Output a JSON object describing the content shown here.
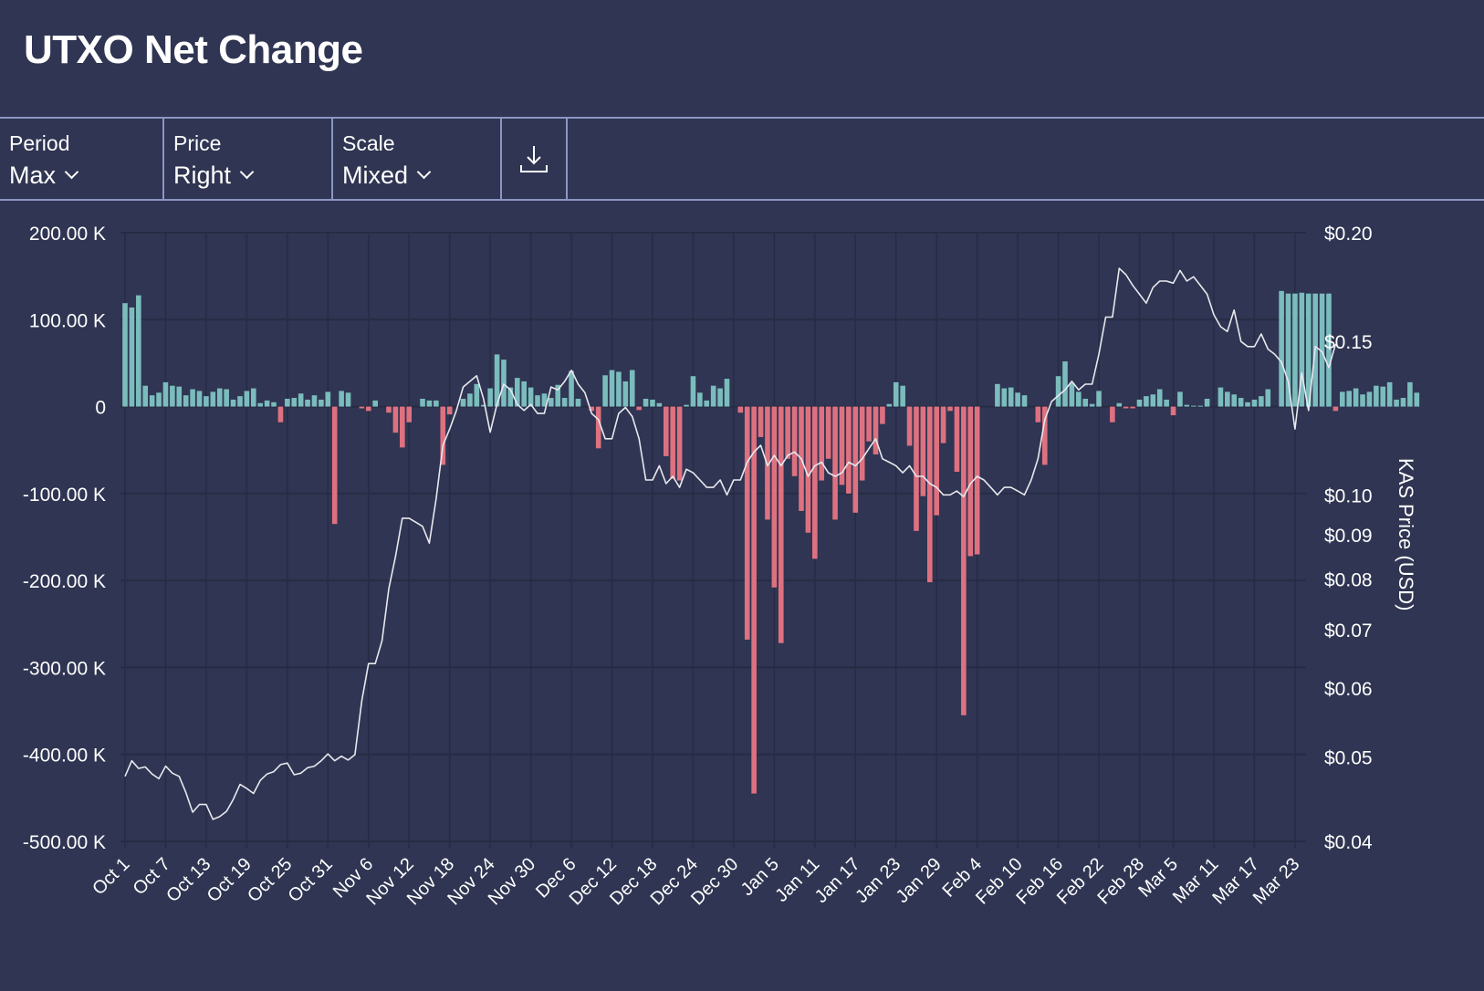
{
  "page": {
    "title": "UTXO Net Change"
  },
  "toolbar": {
    "period": {
      "label": "Period",
      "value": "Max"
    },
    "price": {
      "label": "Price",
      "value": "Right"
    },
    "scale": {
      "label": "Scale",
      "value": "Mixed"
    },
    "download_icon": "download-icon"
  },
  "colors": {
    "background": "#2f3552",
    "positive": "#7bbcbd",
    "negative": "#de7180",
    "price_line": "#e8e8ee",
    "grid": "#272c45",
    "divider": "#8b96c2"
  },
  "chart_data": {
    "type": "bar",
    "title": "UTXO Net Change",
    "xlabel": "",
    "ylabel": "",
    "y2label": "KAS Price (USD)",
    "ylim": [
      -500000,
      200000
    ],
    "y2lim": [
      0.04,
      0.2
    ],
    "y2scale": "log",
    "grid": true,
    "yticks": [
      "200.00 K",
      "100.00 K",
      "0",
      "-100.00 K",
      "-200.00 K",
      "-300.00 K",
      "-400.00 K",
      "-500.00 K"
    ],
    "ytick_values": [
      200000,
      100000,
      0,
      -100000,
      -200000,
      -300000,
      -400000,
      -500000
    ],
    "y2ticks": [
      "$0.20",
      "$0.15",
      "$0.10",
      "$0.09",
      "$0.08",
      "$0.07",
      "$0.06",
      "$0.05",
      "$0.04"
    ],
    "y2tick_values": [
      0.2,
      0.15,
      0.1,
      0.09,
      0.08,
      0.07,
      0.06,
      0.05,
      0.04
    ],
    "xticks": [
      "Oct 1",
      "Oct 7",
      "Oct 13",
      "Oct 19",
      "Oct 25",
      "Oct 31",
      "Nov 6",
      "Nov 12",
      "Nov 18",
      "Nov 24",
      "Nov 30",
      "Dec 6",
      "Dec 12",
      "Dec 18",
      "Dec 24",
      "Dec 30",
      "Jan 5",
      "Jan 11",
      "Jan 17",
      "Jan 23",
      "Jan 29",
      "Feb 4",
      "Feb 10",
      "Feb 16",
      "Feb 22",
      "Feb 28",
      "Mar 5",
      "Mar 11",
      "Mar 17",
      "Mar 23"
    ],
    "xtick_day_index": [
      0,
      6,
      12,
      18,
      24,
      30,
      36,
      42,
      48,
      54,
      60,
      66,
      72,
      78,
      84,
      90,
      96,
      102,
      108,
      114,
      120,
      126,
      132,
      138,
      144,
      150,
      155,
      161,
      167,
      173
    ],
    "series": [
      {
        "name": "UTXO Net Change",
        "type": "bar",
        "axis": "left",
        "values": [
          119000,
          114000,
          128000,
          24000,
          13000,
          16000,
          28000,
          24000,
          23000,
          13000,
          20000,
          18000,
          12000,
          17000,
          21000,
          20000,
          8000,
          12000,
          18000,
          21000,
          4000,
          7000,
          5000,
          -18000,
          9000,
          10000,
          15000,
          8000,
          13000,
          8000,
          17000,
          -135000,
          18000,
          16000,
          0,
          -2000,
          -5000,
          7000,
          0,
          -7000,
          -30000,
          -47000,
          -18000,
          0,
          9000,
          7000,
          7000,
          -67000,
          -9000,
          0,
          9000,
          15000,
          26000,
          2000,
          21000,
          60000,
          54000,
          22000,
          33000,
          29000,
          22000,
          13000,
          15000,
          10000,
          25000,
          10000,
          41000,
          9000,
          0,
          -5000,
          -48000,
          36000,
          42000,
          40000,
          29000,
          42000,
          -4000,
          9000,
          8000,
          4000,
          -57000,
          -83000,
          -85000,
          2000,
          35000,
          16000,
          7000,
          24000,
          21000,
          32000,
          0,
          -7000,
          -268000,
          -445000,
          -35000,
          -130000,
          -208000,
          -272000,
          -60000,
          -80000,
          -120000,
          -145000,
          -175000,
          -85000,
          -60000,
          -130000,
          -90000,
          -100000,
          -122000,
          -85000,
          -40000,
          -55000,
          -20000,
          3000,
          28000,
          24000,
          -45000,
          -143000,
          -103000,
          -202000,
          -125000,
          -42000,
          -5000,
          -75000,
          -355000,
          -172000,
          -170000,
          0,
          0,
          26000,
          21000,
          22000,
          16000,
          13000,
          0,
          -18000,
          -67000,
          0,
          35000,
          52000,
          27000,
          17000,
          9000,
          3000,
          18000,
          0,
          -18000,
          4000,
          -2000,
          -2000,
          8000,
          12000,
          14000,
          20000,
          8000,
          -10000,
          17000,
          2000,
          1000,
          1000,
          9000,
          0,
          22000,
          17000,
          14000,
          10000,
          5000,
          8000,
          12000,
          20000,
          0,
          133000,
          130000,
          130000,
          131000,
          130000,
          130000,
          130000,
          130000,
          -5000,
          17000,
          18000,
          21000,
          14000,
          17000,
          24000,
          23000,
          28000,
          8000,
          10000,
          28000,
          16000
        ]
      },
      {
        "name": "KAS Price (USD)",
        "type": "line",
        "axis": "right",
        "values": [
          0.0475,
          0.0495,
          0.0485,
          0.0487,
          0.0478,
          0.0472,
          0.0488,
          0.0479,
          0.0475,
          0.0455,
          0.0432,
          0.0441,
          0.0441,
          0.0424,
          0.0427,
          0.0433,
          0.0447,
          0.0465,
          0.046,
          0.0454,
          0.047,
          0.0478,
          0.0481,
          0.049,
          0.0492,
          0.0477,
          0.0479,
          0.0486,
          0.0488,
          0.0495,
          0.0504,
          0.0495,
          0.0501,
          0.0496,
          0.0503,
          0.058,
          0.064,
          0.064,
          0.068,
          0.078,
          0.085,
          0.094,
          0.094,
          0.093,
          0.092,
          0.088,
          0.099,
          0.114,
          0.119,
          0.125,
          0.133,
          0.135,
          0.137,
          0.129,
          0.118,
          0.127,
          0.134,
          0.132,
          0.127,
          0.125,
          0.127,
          0.124,
          0.124,
          0.133,
          0.132,
          0.135,
          0.139,
          0.134,
          0.131,
          0.124,
          0.122,
          0.116,
          0.116,
          0.124,
          0.126,
          0.123,
          0.116,
          0.104,
          0.104,
          0.108,
          0.103,
          0.105,
          0.102,
          0.107,
          0.106,
          0.104,
          0.102,
          0.102,
          0.104,
          0.1,
          0.104,
          0.104,
          0.109,
          0.112,
          0.114,
          0.108,
          0.111,
          0.108,
          0.111,
          0.112,
          0.11,
          0.105,
          0.108,
          0.109,
          0.106,
          0.105,
          0.106,
          0.109,
          0.108,
          0.11,
          0.113,
          0.116,
          0.11,
          0.109,
          0.108,
          0.106,
          0.108,
          0.105,
          0.105,
          0.103,
          0.102,
          0.1,
          0.1,
          0.101,
          0.0995,
          0.103,
          0.105,
          0.104,
          0.102,
          0.1,
          0.102,
          0.102,
          0.101,
          0.1,
          0.104,
          0.11,
          0.122,
          0.128,
          0.13,
          0.132,
          0.135,
          0.132,
          0.134,
          0.134,
          0.145,
          0.16,
          0.16,
          0.182,
          0.179,
          0.174,
          0.17,
          0.166,
          0.173,
          0.176,
          0.176,
          0.175,
          0.181,
          0.176,
          0.178,
          0.174,
          0.17,
          0.161,
          0.156,
          0.154,
          0.163,
          0.15,
          0.148,
          0.148,
          0.153,
          0.147,
          0.145,
          0.142,
          0.135,
          0.119,
          0.138,
          0.125,
          0.148,
          0.146,
          0.14,
          0.149
        ]
      }
    ]
  }
}
